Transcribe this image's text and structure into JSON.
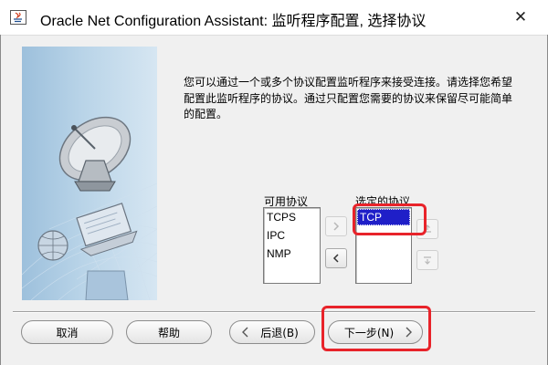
{
  "window": {
    "title": "Oracle Net Configuration Assistant: 监听程序配置, 选择协议",
    "close_glyph": "✕"
  },
  "description": "您可以通过一个或多个协议配置监听程序来接受连接。请选择您希望配置此监听程序的协议。通过只配置您需要的协议来保留尽可能简单的配置。",
  "available": {
    "label": "可用协议",
    "items": [
      "TCPS",
      "IPC",
      "NMP"
    ]
  },
  "selected": {
    "label": "选定的协议",
    "items": [
      "TCP"
    ]
  },
  "buttons": {
    "cancel": "取消",
    "help": "帮助",
    "back": "后退(B)",
    "next": "下一步(N)"
  },
  "colors": {
    "selection": "#1f1fc8",
    "highlight": "#e8232a"
  }
}
